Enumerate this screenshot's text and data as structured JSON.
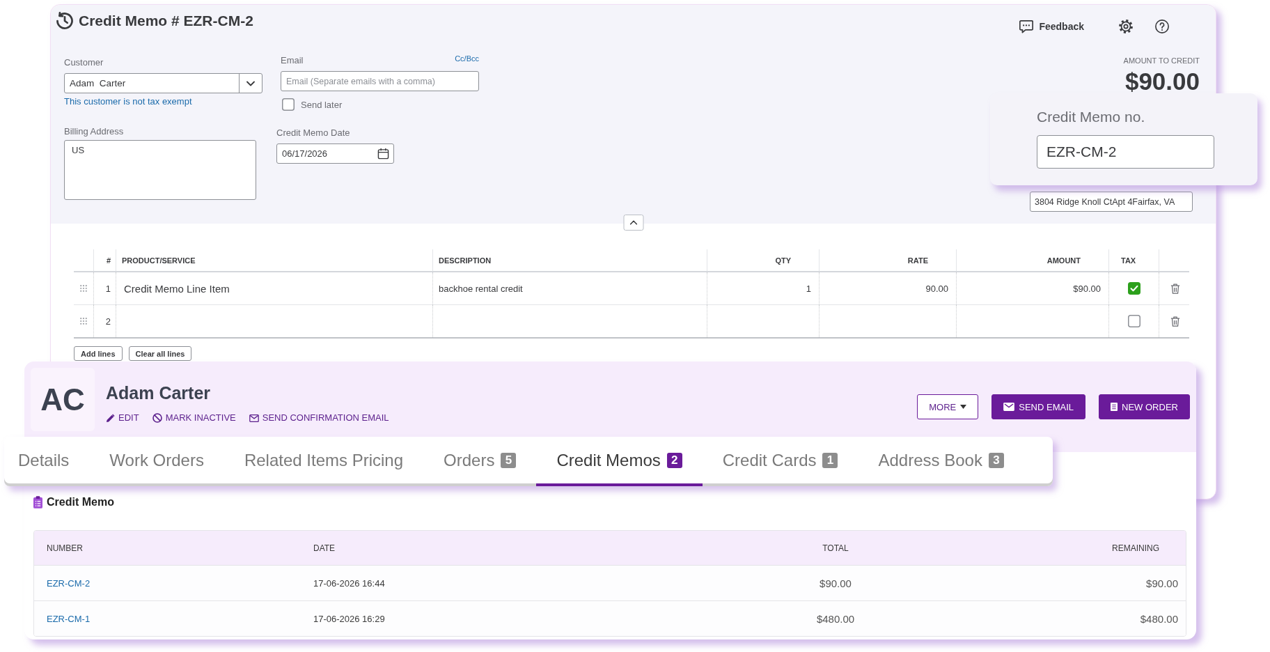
{
  "credit_memo_form": {
    "title": "Credit Memo # EZR-CM-2",
    "feedback": "Feedback",
    "customer": {
      "label": "Customer",
      "value": "Adam  Carter",
      "note": "This customer is not tax exempt"
    },
    "billing_address": {
      "label": "Billing Address",
      "value": "US"
    },
    "email": {
      "label": "Email",
      "cc_bcc": "Cc/Bcc",
      "placeholder": "Email (Separate emails with a comma)"
    },
    "send_later": {
      "label": "Send later",
      "checked": false
    },
    "credit_memo_date": {
      "label": "Credit Memo Date",
      "value": "06/17/2026"
    },
    "amount_to_credit": {
      "label": "AMOUNT TO CREDIT",
      "value": "$90.00"
    },
    "shipping_address": {
      "value": "3804 Ridge Knoll CtApt 4Fairfax, VA"
    },
    "line_items": {
      "columns": [
        "#",
        "PRODUCT/SERVICE",
        "DESCRIPTION",
        "QTY",
        "RATE",
        "AMOUNT",
        "TAX"
      ],
      "rows": [
        {
          "number": "1",
          "product": "Credit Memo Line Item",
          "description": "backhoe rental credit",
          "qty": "1",
          "rate": "90.00",
          "amount": "$90.00",
          "tax": true
        },
        {
          "number": "2",
          "tax": false
        }
      ]
    },
    "buttons": [
      "Add lines",
      "Clear all lines"
    ]
  },
  "credit_memo_number": {
    "label": "Credit Memo no.",
    "value": "EZR-CM-2"
  },
  "customer_card": {
    "initials": "AC",
    "name": "Adam Carter",
    "actions": [
      {
        "kind": "edit",
        "label": "EDIT"
      },
      {
        "kind": "deactivate",
        "label": "MARK INACTIVE"
      },
      {
        "kind": "email",
        "label": "SEND CONFIRMATION EMAIL"
      }
    ],
    "buttons": [
      {
        "kind": "menu",
        "label": "MORE"
      },
      {
        "kind": "email",
        "label": "SEND EMAIL"
      },
      {
        "kind": "order",
        "label": "NEW ORDER"
      }
    ],
    "tabs": [
      {
        "label": "Details",
        "selected": false
      },
      {
        "label": "Work Orders",
        "selected": false
      },
      {
        "label": "Related Items Pricing",
        "selected": false
      },
      {
        "label": "Orders",
        "count": "5",
        "selected": false
      },
      {
        "label": "Credit Memos",
        "count": "2",
        "selected": true
      },
      {
        "label": "Credit Cards",
        "count": "1",
        "selected": false
      },
      {
        "label": "Address Book",
        "count": "3",
        "selected": false
      }
    ],
    "section_title": "Credit Memo",
    "table": {
      "columns": [
        "NUMBER",
        "DATE",
        "TOTAL",
        "REMAINING"
      ],
      "rows": [
        {
          "number": "EZR-CM-2",
          "date": "17-06-2026 16:44",
          "total": "$90.00",
          "remaining": "$90.00"
        },
        {
          "number": "EZR-CM-1",
          "date": "17-06-2026 16:29",
          "total": "$480.00",
          "remaining": "$480.00"
        }
      ]
    }
  }
}
